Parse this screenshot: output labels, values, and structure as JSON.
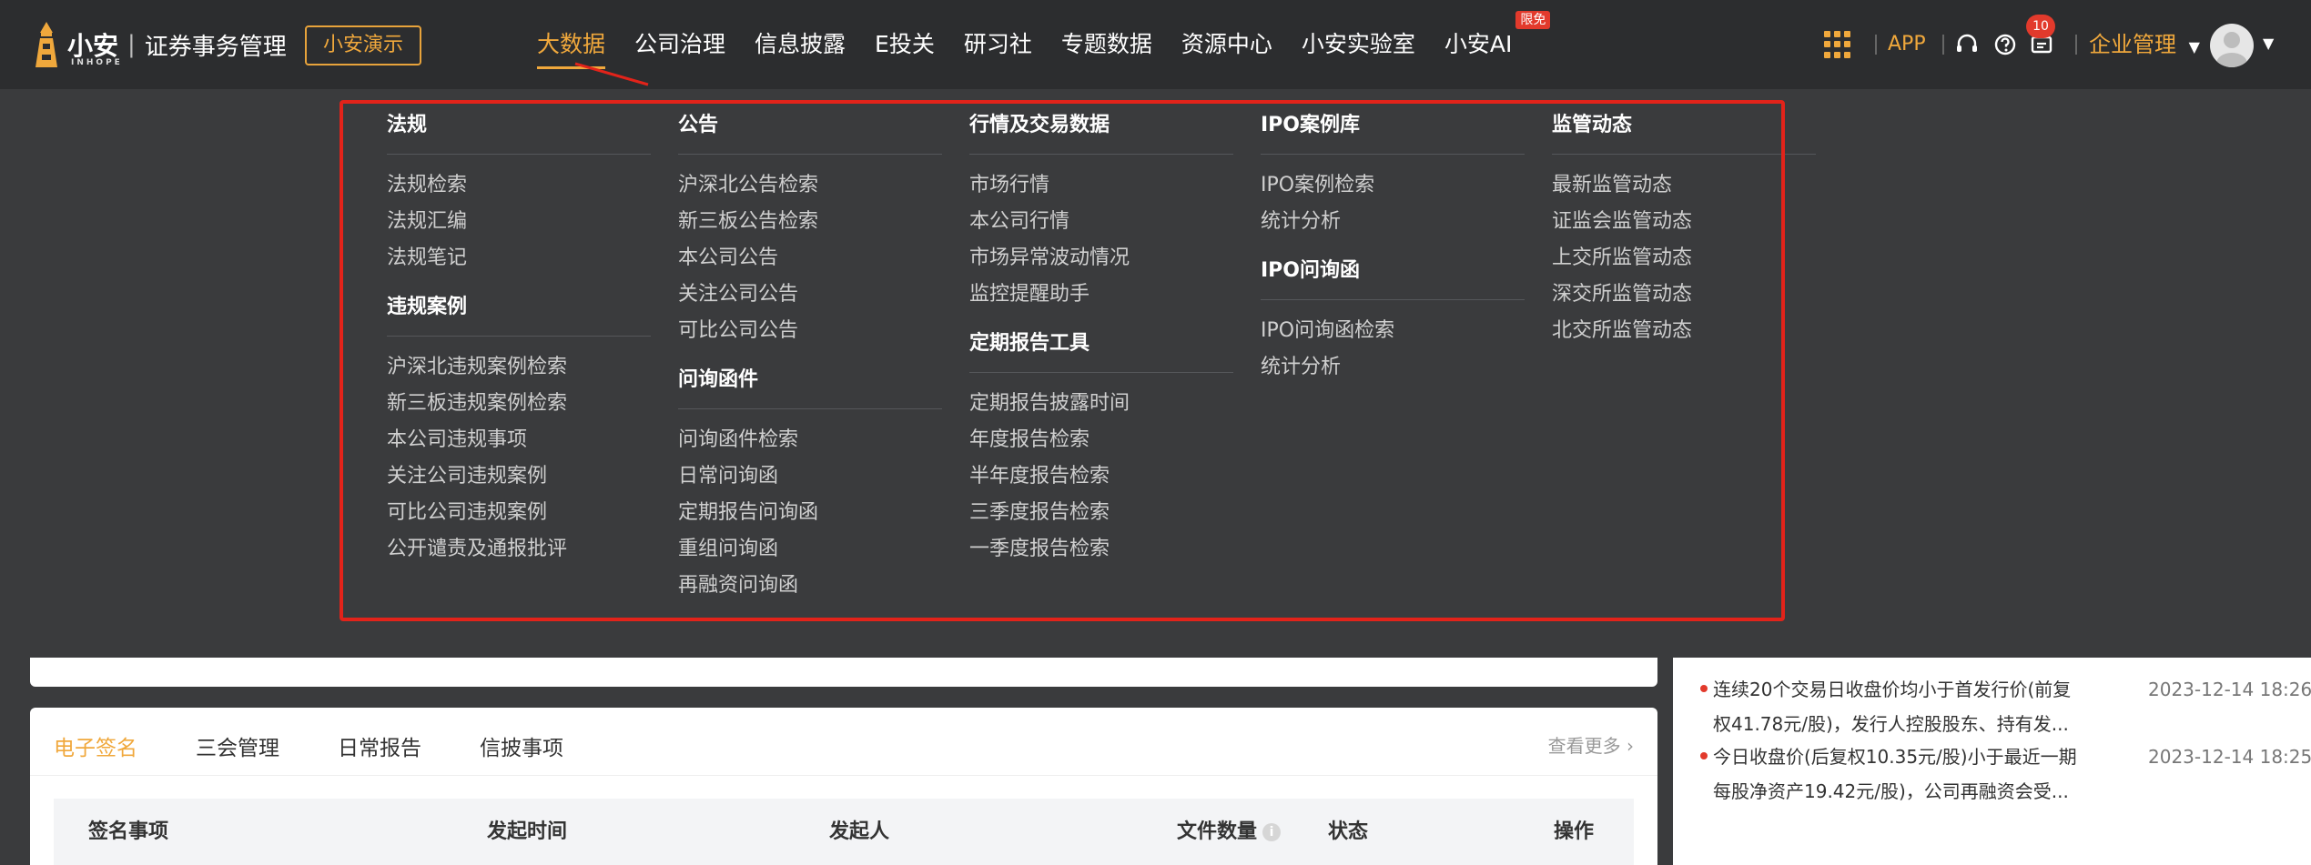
{
  "brand": {
    "logo_title": "小安",
    "logo_sub": "INHOPE",
    "separator": "|",
    "product_name": "证券事务管理",
    "demo_button": "小安演示"
  },
  "nav": {
    "items": [
      {
        "label": "大数据",
        "active": true
      },
      {
        "label": "公司治理"
      },
      {
        "label": "信息披露"
      },
      {
        "label": "E投关"
      },
      {
        "label": "研习社"
      },
      {
        "label": "专题数据"
      },
      {
        "label": "资源中心"
      },
      {
        "label": "小安实验室"
      },
      {
        "label": "小安AI",
        "badge": "限免"
      }
    ]
  },
  "toolbar": {
    "app_label": "APP",
    "notification_count": "10",
    "enterprise_label": "企业管理",
    "icons": [
      "apps-grid-icon",
      "headset-icon",
      "help-icon",
      "message-icon",
      "chevron-down-icon",
      "avatar"
    ]
  },
  "mega_menu": {
    "col1": {
      "heading": "法规",
      "links": [
        "法规检索",
        "法规汇编",
        "法规笔记"
      ],
      "heading2": "违规案例",
      "links2": [
        "沪深北违规案例检索",
        "新三板违规案例检索",
        "本公司违规事项",
        "关注公司违规案例",
        "可比公司违规案例",
        "公开谴责及通报批评"
      ]
    },
    "col2": {
      "heading": "公告",
      "links": [
        "沪深北公告检索",
        "新三板公告检索",
        "本公司公告",
        "关注公司公告",
        "可比公司公告"
      ],
      "heading2": "问询函件",
      "links2": [
        "问询函件检索",
        "日常问询函",
        "定期报告问询函",
        "重组问询函",
        "再融资问询函"
      ]
    },
    "col3": {
      "heading": "行情及交易数据",
      "links": [
        "市场行情",
        "本公司行情",
        "市场异常波动情况",
        "监控提醒助手"
      ],
      "heading2": "定期报告工具",
      "links2": [
        "定期报告披露时间",
        "年度报告检索",
        "半年度报告检索",
        "三季度报告检索",
        "一季度报告检索"
      ]
    },
    "col4": {
      "heading": "IPO案例库",
      "links": [
        "IPO案例检索",
        "统计分析"
      ],
      "heading2": "IPO问询函",
      "links2": [
        "IPO问询函检索",
        "统计分析"
      ]
    },
    "col5": {
      "heading": "监管动态",
      "links": [
        "最新监管动态",
        "证监会监管动态",
        "上交所监管动态",
        "深交所监管动态",
        "北交所监管动态"
      ]
    }
  },
  "tabs": {
    "items": [
      "电子签名",
      "三会管理",
      "日常报告",
      "信披事项"
    ],
    "active": 0,
    "see_more": "查看更多 ›"
  },
  "table": {
    "headers": [
      "签名事项",
      "发起时间",
      "发起人",
      "文件数量",
      "状态",
      "操作"
    ],
    "info_icon": "i"
  },
  "news": [
    {
      "text_line1": "连续20个交易日收盘价均小于首发行价(前复",
      "text_line2": "权41.78元/股)，发行人控股股东、持有发...",
      "time": "2023-12-14 18:26"
    },
    {
      "text_line1": "今日收盘价(后复权10.35元/股)小于最近一期",
      "text_line2": "每股净资产19.42元/股)，公司再融资会受...",
      "time": "2023-12-14 18:25"
    }
  ],
  "colors": {
    "accent": "#f0a83c",
    "topbar_bg": "#2c2d2f",
    "menu_bg": "#3a3b3d",
    "highlight_frame": "#e2231a",
    "badge_red": "#e23a2c"
  }
}
